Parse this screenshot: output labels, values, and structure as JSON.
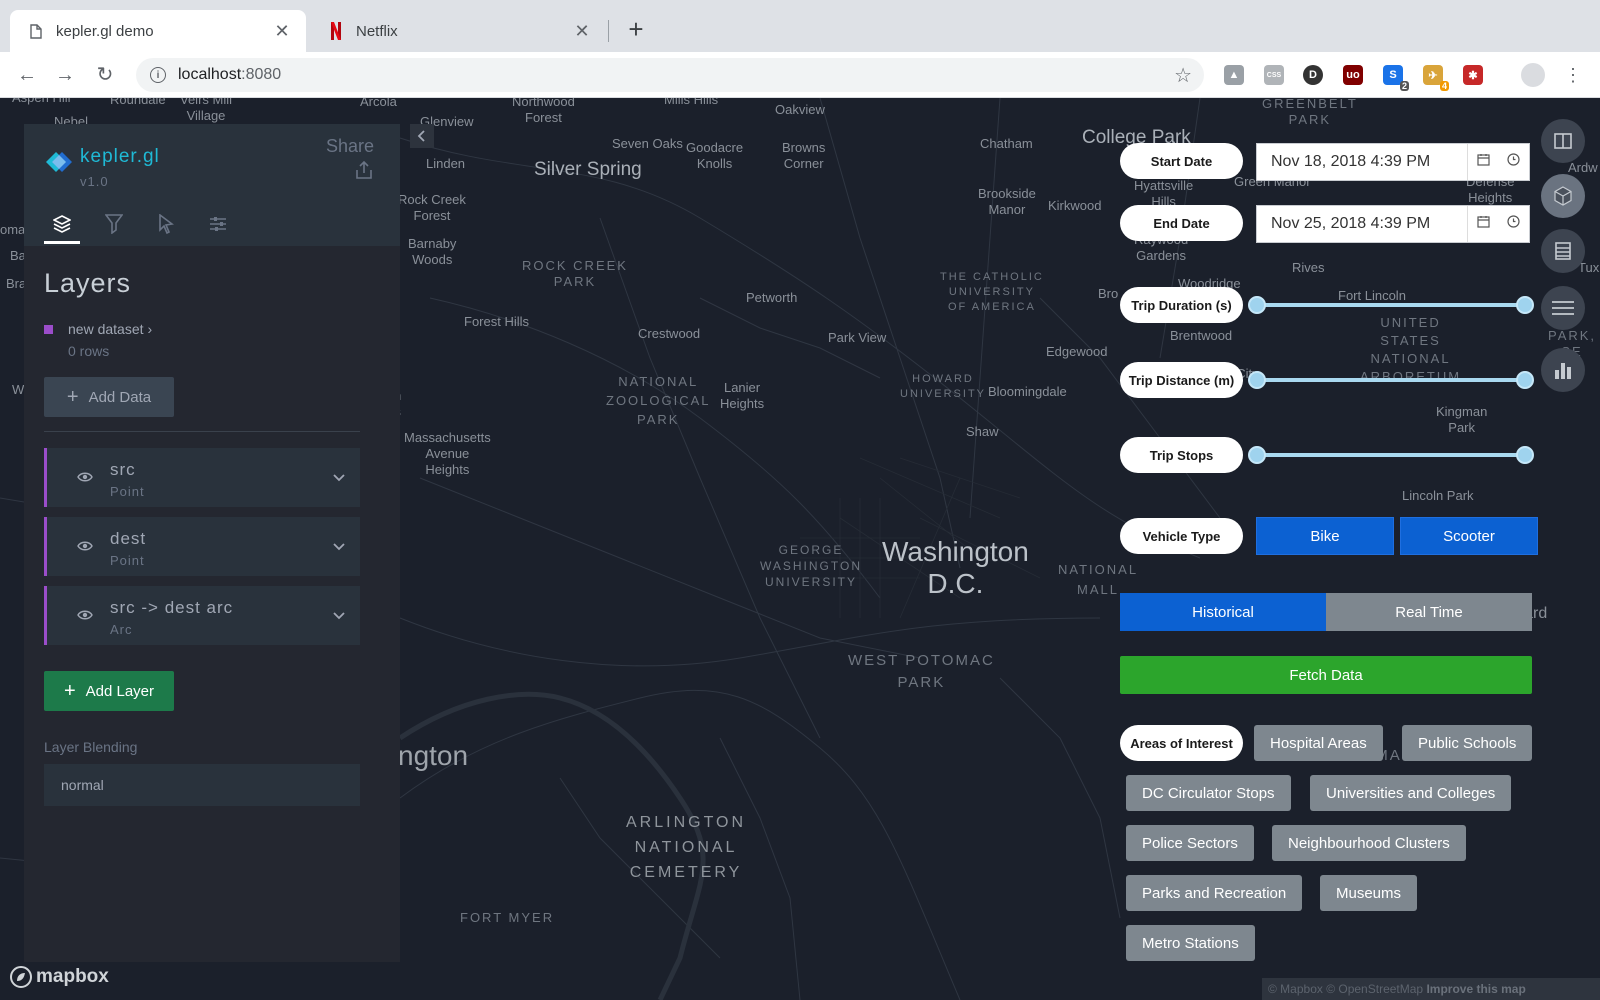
{
  "browser": {
    "tabs": [
      {
        "title": "kepler.gl demo",
        "active": true
      },
      {
        "title": "Netflix",
        "active": false
      }
    ],
    "url_host": "localhost",
    "url_port": ":8080"
  },
  "extensions": [
    {
      "name": "drive-icon",
      "color": "#9aa0a6",
      "badge": ""
    },
    {
      "name": "css-icon",
      "color": "#9aa0a6",
      "badge": ""
    },
    {
      "name": "d-icon",
      "color": "#333333",
      "badge": ""
    },
    {
      "name": "ublock-icon",
      "color": "#800000",
      "badge": ""
    },
    {
      "name": "s-icon",
      "color": "#1a73e8",
      "badge": "2"
    },
    {
      "name": "ghostery-icon",
      "color": "#d9a43a",
      "badge": "4"
    },
    {
      "name": "puzzle-icon",
      "color": "#c62828",
      "badge": ""
    }
  ],
  "map_labels": [
    {
      "text": "Aspen Hill",
      "cls": ""
    },
    {
      "text": "Roundale",
      "cls": ""
    },
    {
      "text": "Veirs Mill\nVillage",
      "cls": ""
    },
    {
      "text": "Arcola",
      "cls": ""
    },
    {
      "text": "Northwood\nForest",
      "cls": ""
    },
    {
      "text": "Mills Hills",
      "cls": ""
    },
    {
      "text": "Oakview",
      "cls": ""
    },
    {
      "text": "GREENBELT\nPARK",
      "cls": "caps"
    },
    {
      "text": "Nebel",
      "cls": ""
    },
    {
      "text": "Glenview",
      "cls": ""
    },
    {
      "text": "Seven Oaks",
      "cls": ""
    },
    {
      "text": "Goodacre\nKnolls",
      "cls": ""
    },
    {
      "text": "Browns\nCorner",
      "cls": ""
    },
    {
      "text": "Chatham",
      "cls": ""
    },
    {
      "text": "College Park",
      "cls": "big"
    },
    {
      "text": "Linden",
      "cls": ""
    },
    {
      "text": "Silver Spring",
      "cls": "big"
    },
    {
      "text": "Hyattsville\nHills",
      "cls": ""
    },
    {
      "text": "Green Manor",
      "cls": ""
    },
    {
      "text": "Defense\nHeights",
      "cls": ""
    },
    {
      "text": "Rock Creek\nForest",
      "cls": ""
    },
    {
      "text": "Brookside\nManor",
      "cls": ""
    },
    {
      "text": "Kirkwood",
      "cls": ""
    },
    {
      "text": "Barnaby\nWoods",
      "cls": ""
    },
    {
      "text": "Raywood\nGardens",
      "cls": ""
    },
    {
      "text": "ROCK CREEK\nPARK",
      "cls": "caps"
    },
    {
      "text": "THE CATHOLIC\nUNIVERSITY\nOF AMERICA",
      "cls": "caps"
    },
    {
      "text": "Woodridge",
      "cls": ""
    },
    {
      "text": "Rives",
      "cls": ""
    },
    {
      "text": "Petworth",
      "cls": ""
    },
    {
      "text": "Bro",
      "cls": ""
    },
    {
      "text": "Fort Lincoln",
      "cls": ""
    },
    {
      "text": "Forest Hills",
      "cls": ""
    },
    {
      "text": "Crestwood",
      "cls": ""
    },
    {
      "text": "Park View",
      "cls": ""
    },
    {
      "text": "Brentwood",
      "cls": ""
    },
    {
      "text": "UNITED\nSTATES\nNATIONAL\nARBORETUM",
      "cls": "caps"
    },
    {
      "text": "Edgewood",
      "cls": ""
    },
    {
      "text": "NATIONAL\nZOOLOGICAL\nPARK",
      "cls": "caps"
    },
    {
      "text": "Lanier\nHeights",
      "cls": ""
    },
    {
      "text": "HOWARD\nUNIVERSITY",
      "cls": "caps"
    },
    {
      "text": "Bloomingdale",
      "cls": ""
    },
    {
      "text": "Ivy City",
      "cls": ""
    },
    {
      "text": "Kingman\nPark",
      "cls": ""
    },
    {
      "text": "Massachusetts\nAvenue\nHeights",
      "cls": ""
    },
    {
      "text": "Shaw",
      "cls": ""
    },
    {
      "text": "Lincoln Park",
      "cls": ""
    },
    {
      "text": "GEORGE\nWASHINGTON\nUNIVERSITY",
      "cls": "caps"
    },
    {
      "text": "Washington\nD.C.",
      "cls": "dc"
    },
    {
      "text": "NATIONAL\nMALL",
      "cls": "caps"
    },
    {
      "text": "Navy Yard",
      "cls": ""
    },
    {
      "text": "WEST POTOMAC\nPARK",
      "cls": "caps"
    },
    {
      "text": "EAST POTOMAC",
      "cls": "caps"
    },
    {
      "text": "ngton",
      "cls": "huge"
    },
    {
      "text": "ARLINGTON\nNATIONAL\nCEMETERY",
      "cls": "bigcaps"
    },
    {
      "text": "FORT MYER",
      "cls": "caps"
    },
    {
      "text": "W",
      "cls": ""
    },
    {
      "text": "Ba",
      "cls": ""
    },
    {
      "text": "Bra",
      "cls": ""
    },
    {
      "text": "n\ns",
      "cls": ""
    },
    {
      "text": "Ardw",
      "cls": ""
    },
    {
      "text": "Tux",
      "cls": ""
    },
    {
      "text": "PARK,\nSE",
      "cls": "caps"
    },
    {
      "text": "oma",
      "cls": ""
    }
  ],
  "sidepanel": {
    "logo_name": "kepler.gl",
    "logo_version": "v1.0",
    "share_label": "Share",
    "section_title": "Layers",
    "dataset_name": "new dataset",
    "dataset_rows": "0 rows",
    "add_data_label": "Add Data",
    "layers": [
      {
        "name": "src",
        "type": "Point"
      },
      {
        "name": "dest",
        "type": "Point"
      },
      {
        "name": "src -> dest arc",
        "type": "Arc"
      }
    ],
    "add_layer_label": "Add Layer",
    "blending_label": "Layer Blending",
    "blending_value": "normal",
    "accent_color": "#9b4dca",
    "logo_color": "#1fbad6"
  },
  "filters": {
    "start_date_label": "Start Date",
    "start_date_value": "Nov 18, 2018 4:39 PM",
    "end_date_label": "End Date",
    "end_date_value": "Nov 25, 2018 4:39 PM",
    "trip_duration_label": "Trip Duration (s)",
    "trip_distance_label": "Trip Distance (m)",
    "trip_stops_label": "Trip Stops",
    "vehicle_type_label": "Vehicle Type",
    "vehicle_types": [
      "Bike",
      "Scooter"
    ],
    "mode_historical": "Historical",
    "mode_realtime": "Real Time",
    "selected_mode": "Historical",
    "fetch_label": "Fetch Data",
    "areas_label": "Areas of Interest",
    "areas": [
      "Hospital Areas",
      "Public Schools",
      "DC Circulator Stops",
      "Universities and Colleges",
      "Police Sectors",
      "Neighbourhood Clusters",
      "Parks and Recreation",
      "Museums",
      "Metro Stations"
    ],
    "slider_range_fraction": [
      0,
      1
    ]
  },
  "map_controls": [
    {
      "name": "split-map-icon"
    },
    {
      "name": "3d-view-icon"
    },
    {
      "name": "legend-icon"
    },
    {
      "name": "menu-icon"
    },
    {
      "name": "chart-icon"
    }
  ],
  "attribution": {
    "mapbox": "mapbox",
    "text": "© Mapbox © OpenStreetMap",
    "improve": "Improve this map"
  }
}
